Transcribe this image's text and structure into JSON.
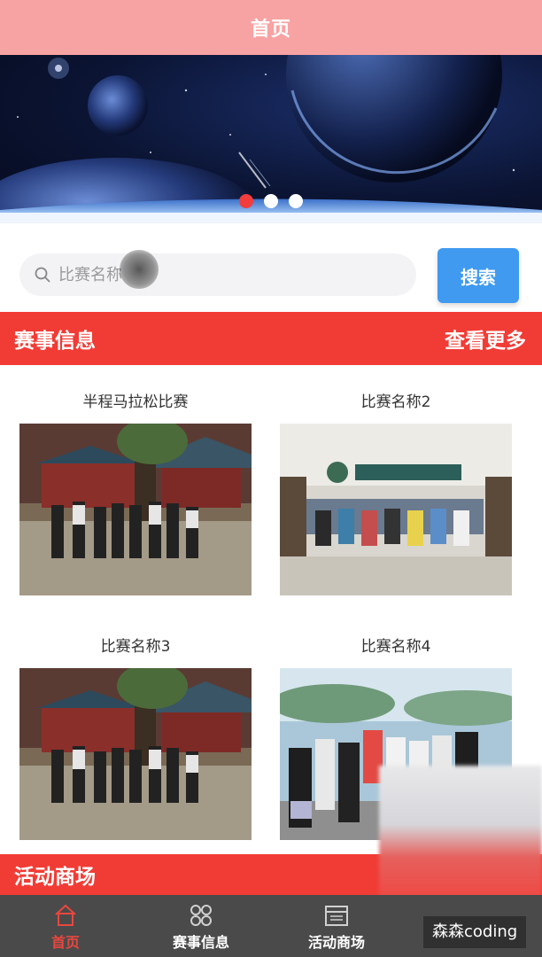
{
  "header": {
    "title": "首页"
  },
  "banner": {
    "slide_count": 3,
    "active_index": 0
  },
  "search": {
    "placeholder": "比赛名称",
    "button_label": "搜索"
  },
  "events_section": {
    "title": "赛事信息",
    "more_label": "查看更多"
  },
  "events": [
    {
      "name": "半程马拉松比赛"
    },
    {
      "name": "比赛名称2"
    },
    {
      "name": "比赛名称3"
    },
    {
      "name": "比赛名称4"
    }
  ],
  "shop_section": {
    "title": "活动商场"
  },
  "tabbar": {
    "items": [
      {
        "label": "首页",
        "icon": "home-icon",
        "active": true
      },
      {
        "label": "赛事信息",
        "icon": "grid-icon",
        "active": false
      },
      {
        "label": "活动商场",
        "icon": "calendar-icon",
        "active": false
      }
    ]
  },
  "watermark": {
    "text": "森森coding"
  },
  "colors": {
    "header": "#f8a3a3",
    "section": "#f13c35",
    "search_button": "#3f9af0",
    "tab_active": "#e8473f",
    "tabbar": "#4a4a4a"
  }
}
